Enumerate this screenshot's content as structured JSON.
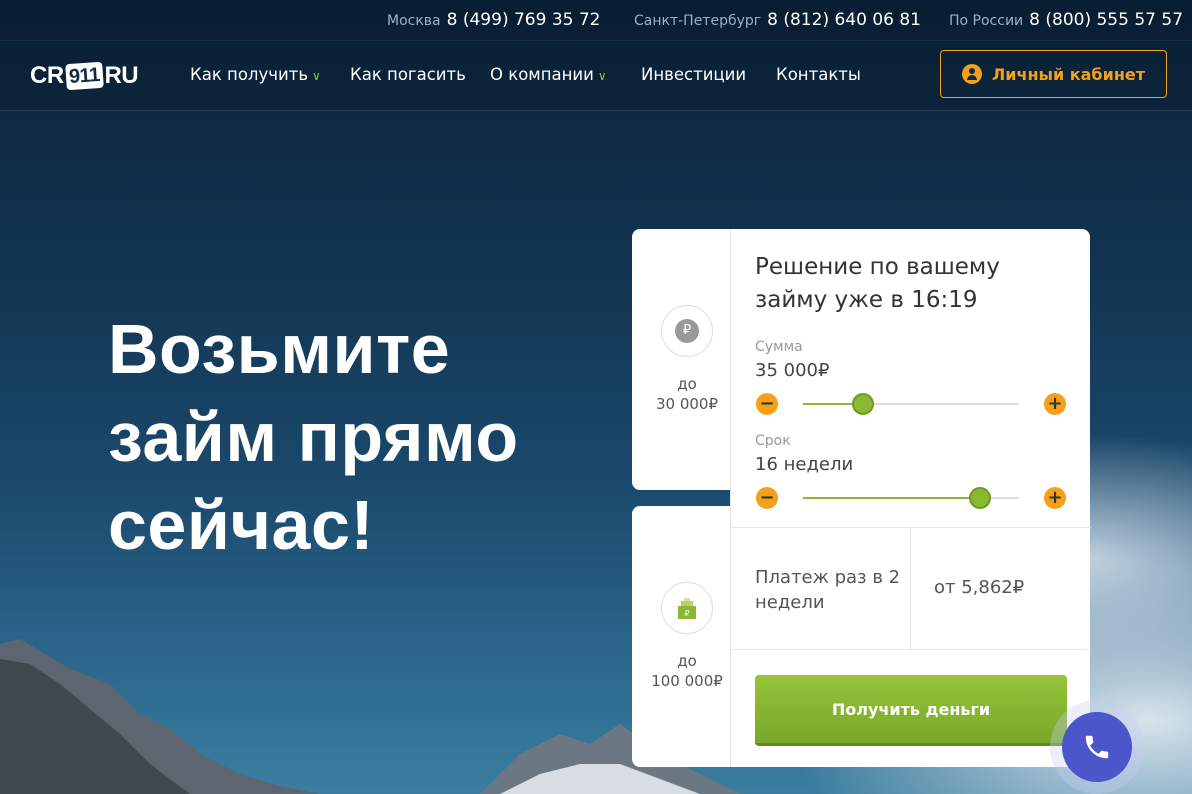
{
  "topbar": {
    "phones": [
      {
        "city": "Москва",
        "number": "8 (499) 769 35 72"
      },
      {
        "city": "Санкт-Петербург",
        "number": "8 (812) 640 06 81"
      },
      {
        "city": "По России",
        "number": "8 (800) 555 57 57"
      }
    ]
  },
  "nav": {
    "logo": {
      "left": "CR",
      "mid": "911",
      "right": "RU"
    },
    "items": [
      {
        "label": "Как получить",
        "dropdown": true
      },
      {
        "label": "Как погасить",
        "dropdown": false
      },
      {
        "label": "О компании",
        "dropdown": true
      },
      {
        "label": "Инвестиции",
        "dropdown": false
      },
      {
        "label": "Контакты",
        "dropdown": false
      }
    ],
    "cabinet_label": "Личный кабинет",
    "cabinet_icon": "user-icon"
  },
  "hero": {
    "lines": [
      "Возьмите",
      "займ прямо",
      "сейчас!"
    ]
  },
  "side_cards": [
    {
      "icon": "ruble-coin-icon",
      "prefix": "до",
      "amount": "30 000₽"
    },
    {
      "icon": "ruble-box-icon",
      "prefix": "до",
      "amount": "100 000₽"
    }
  ],
  "calculator": {
    "title": "Решение по вашему займу уже в 16:19",
    "amount": {
      "label": "Сумма",
      "value": "35 000₽",
      "level": 0.28
    },
    "term": {
      "label": "Срок",
      "value": "16 недели",
      "level": 0.82
    },
    "payment_label": "Платеж раз в 2 недели",
    "payment_value": "от 5,862₽",
    "submit_label": "Получить деньги"
  },
  "colors": {
    "accent_orange": "#f5a01a",
    "accent_green": "#8ab833",
    "call_button": "#4a56c9"
  }
}
